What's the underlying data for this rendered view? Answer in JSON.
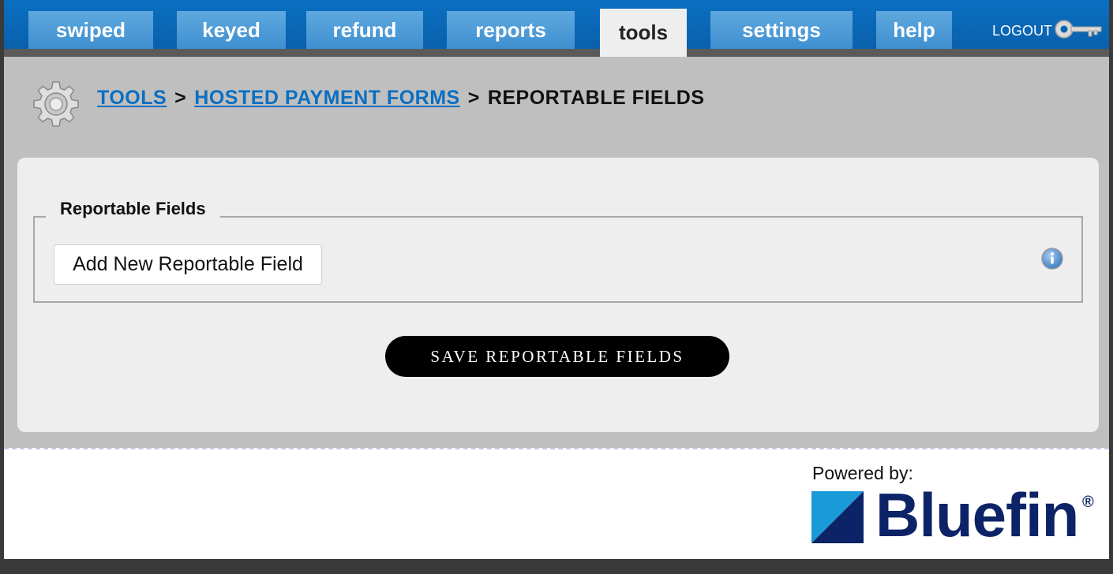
{
  "nav": {
    "tabs": [
      {
        "label": "swiped",
        "active": false
      },
      {
        "label": "keyed",
        "active": false
      },
      {
        "label": "refund",
        "active": false
      },
      {
        "label": "reports",
        "active": false
      },
      {
        "label": "tools",
        "active": true
      },
      {
        "label": "settings",
        "active": false
      },
      {
        "label": "help",
        "active": false
      }
    ],
    "logout_label": "LOGOUT",
    "logout_icon": "key-icon"
  },
  "breadcrumb": {
    "icon": "gear-icon",
    "items": [
      {
        "label": "TOOLS",
        "link": true
      },
      {
        "label": "HOSTED PAYMENT FORMS",
        "link": true
      },
      {
        "label": "REPORTABLE FIELDS",
        "link": false
      }
    ],
    "separator": ">"
  },
  "panel": {
    "legend": "Reportable Fields",
    "add_button_label": "Add New Reportable Field",
    "info_icon": "info-icon",
    "save_button_label": "SAVE REPORTABLE FIELDS"
  },
  "footer": {
    "powered_by": "Powered by:",
    "brand": "Bluefin",
    "brand_mark": "®"
  },
  "colors": {
    "nav_blue": "#0a6fc2",
    "tab_blue": "#4f9bd7",
    "brand_navy": "#0d2368",
    "brand_cyan": "#1a9ad6"
  }
}
